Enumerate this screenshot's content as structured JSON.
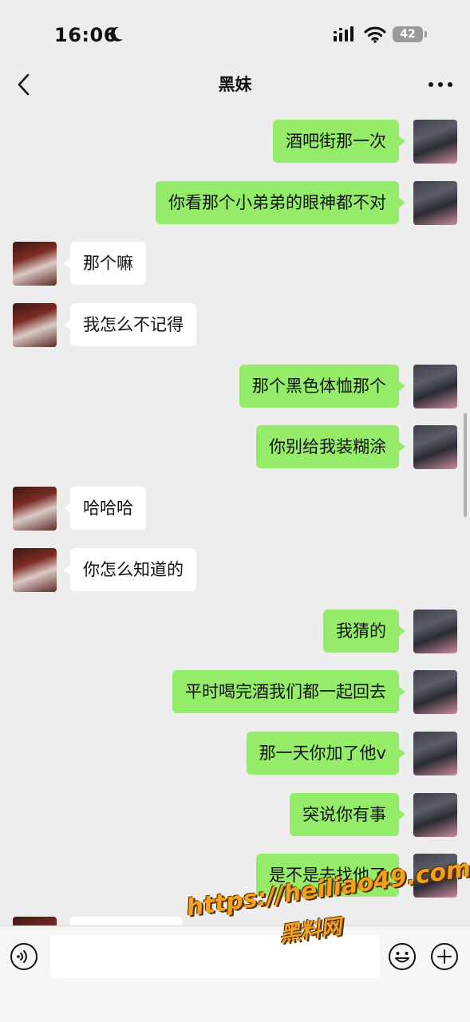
{
  "status_bar": {
    "time": "16:06",
    "battery": "42"
  },
  "header": {
    "title": "黑妹"
  },
  "messages": [
    {
      "side": "right",
      "text": "酒吧街那一次"
    },
    {
      "side": "right",
      "text": "你看那个小弟弟的眼神都不对"
    },
    {
      "side": "left",
      "text": "那个嘛"
    },
    {
      "side": "left",
      "text": "我怎么不记得"
    },
    {
      "side": "right",
      "text": "那个黑色体恤那个"
    },
    {
      "side": "right",
      "text": "你别给我装糊涂"
    },
    {
      "side": "left",
      "text": "哈哈哈"
    },
    {
      "side": "left",
      "text": "你怎么知道的"
    },
    {
      "side": "right",
      "text": "我猜的"
    },
    {
      "side": "right",
      "text": "平时喝完酒我们都一起回去"
    },
    {
      "side": "right",
      "text": "那一天你加了他v"
    },
    {
      "side": "right",
      "text": "突说你有事"
    },
    {
      "side": "right",
      "text": "是不是去找他了"
    }
  ],
  "watermark": {
    "line1": "https://heiliao49.com",
    "line2": "黑料网"
  },
  "input": {
    "placeholder": ""
  },
  "icons": {
    "back": "chevron-left-icon",
    "more": "more-dots-icon",
    "voice": "voice-icon",
    "emoji": "emoji-icon",
    "plus": "plus-icon"
  },
  "colors": {
    "sent_bubble": "#95ec69",
    "received_bubble": "#ffffff",
    "background": "#ededed"
  }
}
